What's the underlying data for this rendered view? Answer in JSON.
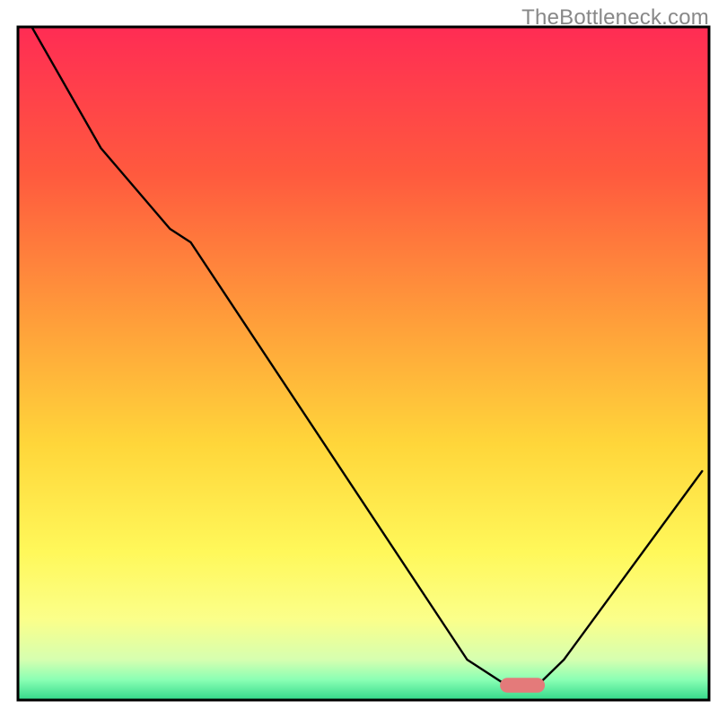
{
  "watermark": "TheBottleneck.com",
  "chart_data": {
    "type": "line",
    "title": "",
    "xlabel": "",
    "ylabel": "",
    "xlim": [
      0,
      100
    ],
    "ylim": [
      0,
      100
    ],
    "background_gradient_stops": [
      {
        "offset": 0.0,
        "color": "#ff2c54"
      },
      {
        "offset": 0.22,
        "color": "#ff5a3e"
      },
      {
        "offset": 0.45,
        "color": "#ffa23a"
      },
      {
        "offset": 0.62,
        "color": "#ffd63a"
      },
      {
        "offset": 0.78,
        "color": "#fff85a"
      },
      {
        "offset": 0.88,
        "color": "#fbff8a"
      },
      {
        "offset": 0.94,
        "color": "#d6ffb0"
      },
      {
        "offset": 0.97,
        "color": "#8affb4"
      },
      {
        "offset": 1.0,
        "color": "#32d88a"
      }
    ],
    "series": [
      {
        "name": "bottleneck-curve",
        "x": [
          2,
          12,
          22,
          25,
          65,
          71,
          75,
          79,
          99
        ],
        "y": [
          100,
          82,
          70,
          68,
          6,
          2,
          2,
          6,
          34
        ]
      }
    ],
    "marker": {
      "name": "optimal-zone-marker",
      "x_center": 73,
      "y_center": 2.2,
      "width": 6.5,
      "height": 2.2,
      "color": "#e47a7a"
    },
    "frame_color": "#000000",
    "frame_width": 3,
    "curve_color": "#000000",
    "curve_width": 2.4
  }
}
